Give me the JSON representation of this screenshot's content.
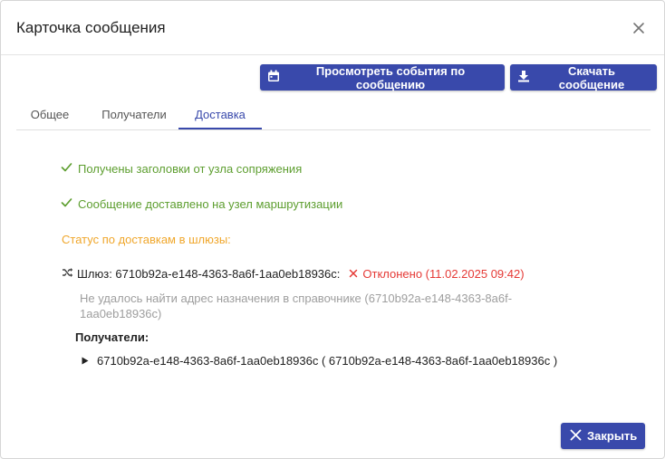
{
  "dialog": {
    "title": "Карточка сообщения"
  },
  "toolbar": {
    "events_label": "Просмотреть события по сообщению",
    "download_label": "Скачать сообщение"
  },
  "tabs": [
    {
      "label": "Общее"
    },
    {
      "label": "Получатели"
    },
    {
      "label": "Доставка",
      "active": true
    }
  ],
  "delivery": {
    "status_headers": "Получены заголовки от узла сопряжения",
    "status_routed": "Сообщение доставлено на узел маршрутизации",
    "gateway_status_label": "Статус по доставкам в шлюзы:",
    "gateway": {
      "label": "Шлюз: 6710b92a-e148-4363-8a6f-1aa0eb18936c:",
      "status": "Отклонено (11.02.2025 09:42)",
      "error": "Не удалось найти адрес назначения в справочнике (6710b92a-e148-4363-8a6f-1aa0eb18936c)",
      "recipients_label": "Получатели:",
      "recipient": "6710b92a-e148-4363-8a6f-1aa0eb18936c ( 6710b92a-e148-4363-8a6f-1aa0eb18936c )"
    }
  },
  "footer": {
    "close_label": "Закрыть"
  },
  "colors": {
    "primary": "#3949ab",
    "success": "#5d9e2f",
    "warning": "#f0a72c",
    "error": "#e53935"
  },
  "icons": {
    "close": "close-icon",
    "calendar": "calendar-icon",
    "download": "download-icon",
    "check": "check-icon",
    "shuffle": "shuffle-icon",
    "reject": "x-icon",
    "triangle": "triangle-right-icon"
  }
}
